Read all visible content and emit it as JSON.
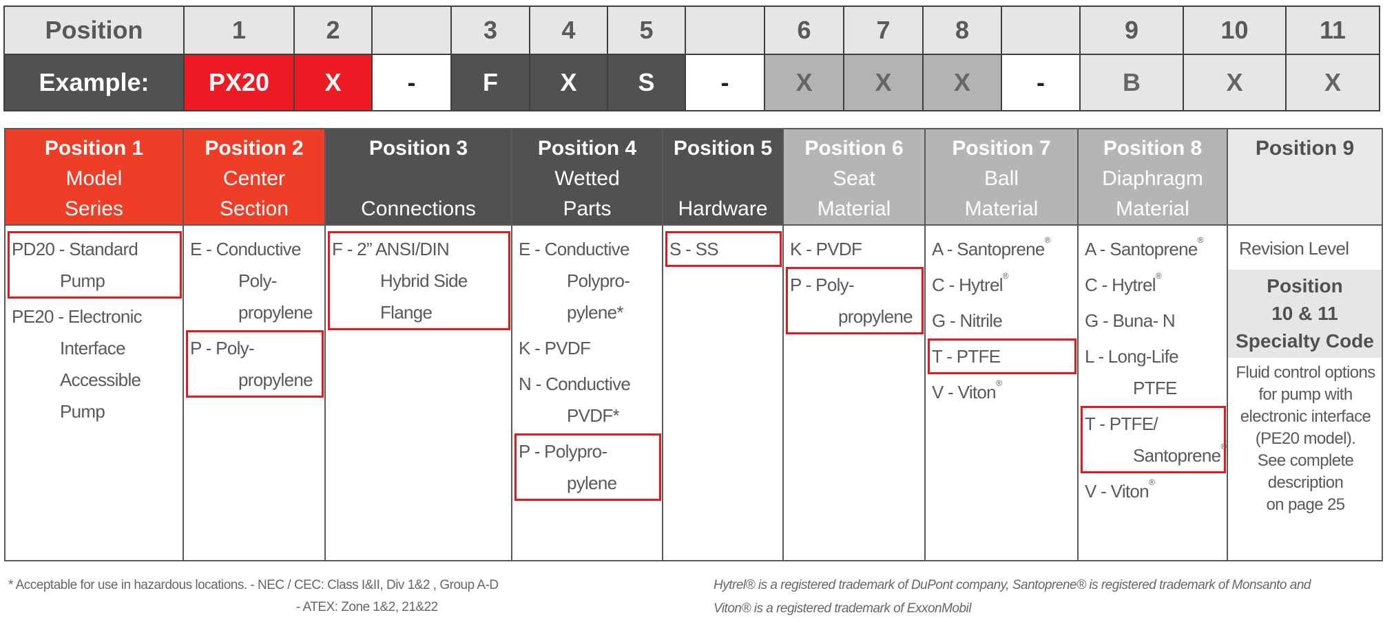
{
  "code_table": {
    "position_label": "Position",
    "example_label": "Example:",
    "positions": [
      "1",
      "2",
      "",
      "3",
      "4",
      "5",
      "",
      "6",
      "7",
      "8",
      "",
      "9",
      "10",
      "11"
    ],
    "example": [
      "PX20",
      "X",
      "-",
      "F",
      "X",
      "S",
      "-",
      "X",
      "X",
      "X",
      "-",
      "B",
      "X",
      "X"
    ]
  },
  "columns": [
    {
      "title": "Position 1",
      "sub1": "Model",
      "sub2": "Series",
      "items": [
        {
          "lines": [
            "PD20 - Standard",
            "Pump"
          ],
          "highlighted": true
        },
        {
          "lines": [
            "PE20 - Electronic",
            "Interface",
            "Accessible",
            "Pump"
          ],
          "highlighted": false
        }
      ]
    },
    {
      "title": "Position 2",
      "sub1": "Center",
      "sub2": "Section",
      "items": [
        {
          "lines": [
            "E - Conductive",
            "Poly-",
            "propylene"
          ],
          "highlighted": false
        },
        {
          "lines": [
            "P - Poly-",
            "propylene"
          ],
          "highlighted": true
        }
      ]
    },
    {
      "title": "Position 3",
      "sub1": "",
      "sub2": "Connections",
      "items": [
        {
          "lines": [
            "F - 2” ANSI/DIN",
            "Hybrid Side",
            "Flange"
          ],
          "highlighted": true
        }
      ]
    },
    {
      "title": "Position 4",
      "sub1": "Wetted",
      "sub2": "Parts",
      "items": [
        {
          "lines": [
            "E - Conductive",
            "Polypro-",
            "pylene*"
          ],
          "highlighted": false
        },
        {
          "lines": [
            "K - PVDF"
          ],
          "highlighted": false
        },
        {
          "lines": [
            "N - Conductive",
            "PVDF*"
          ],
          "highlighted": false
        },
        {
          "lines": [
            "P - Polypro-",
            "pylene"
          ],
          "highlighted": true
        }
      ]
    },
    {
      "title": "Position 5",
      "sub1": "",
      "sub2": "Hardware",
      "items": [
        {
          "lines": [
            "S - SS"
          ],
          "highlighted": true
        }
      ]
    },
    {
      "title": "Position 6",
      "sub1": "Seat",
      "sub2": "Material",
      "items": [
        {
          "lines": [
            "K - PVDF"
          ],
          "highlighted": false
        },
        {
          "lines": [
            "P - Poly-",
            "propylene"
          ],
          "highlighted": true
        }
      ]
    },
    {
      "title": "Position 7",
      "sub1": "Ball",
      "sub2": "Material",
      "items": [
        {
          "lines": [
            "A - Santoprene®"
          ],
          "highlighted": false
        },
        {
          "lines": [
            "C - Hytrel®"
          ],
          "highlighted": false
        },
        {
          "lines": [
            "G - Nitrile"
          ],
          "highlighted": false
        },
        {
          "lines": [
            "T - PTFE"
          ],
          "highlighted": true
        },
        {
          "lines": [
            "V - Viton®"
          ],
          "highlighted": false
        }
      ]
    },
    {
      "title": "Position 8",
      "sub1": "Diaphragm",
      "sub2": "Material",
      "items": [
        {
          "lines": [
            "A - Santoprene®"
          ],
          "highlighted": false
        },
        {
          "lines": [
            "C - Hytrel®"
          ],
          "highlighted": false
        },
        {
          "lines": [
            "G - Buna- N"
          ],
          "highlighted": false
        },
        {
          "lines": [
            "L - Long-Life",
            "PTFE"
          ],
          "highlighted": false
        },
        {
          "lines": [
            "T - PTFE/",
            "Santoprene®"
          ],
          "highlighted": true
        },
        {
          "lines": [
            "V - Viton®"
          ],
          "highlighted": false
        }
      ]
    },
    {
      "title": "Position 9",
      "sub1": "",
      "sub2": "",
      "items": []
    }
  ],
  "position9": {
    "revision": "Revision Level",
    "specialty_title1": "Position",
    "specialty_title2": "10 & 11",
    "specialty_title3": "Specialty Code",
    "description": [
      "Fluid control options",
      "for pump with",
      "electronic interface",
      "(PE20 model).",
      "See complete",
      "description",
      "on page 25"
    ]
  },
  "footer": {
    "hazard_note": "* Acceptable for use in hazardous locations.",
    "nec": "- NEC / CEC: Class I&II, Div 1&2 , Group A-D",
    "atex": "- ATEX: Zone 1&2, 21&22",
    "trademark1": "Hytrel® is a registered trademark of DuPont company, Santoprene® is registered trademark of Monsanto and",
    "trademark2": "Viton® is a registered trademark of ExxonMobil"
  },
  "colors": {
    "red": "#ed1c24",
    "header_red": "#ee3e27",
    "dark": "#505153",
    "gray": "#b3b3b3",
    "light": "#e6e6e6",
    "highlight": "#e2181f"
  }
}
